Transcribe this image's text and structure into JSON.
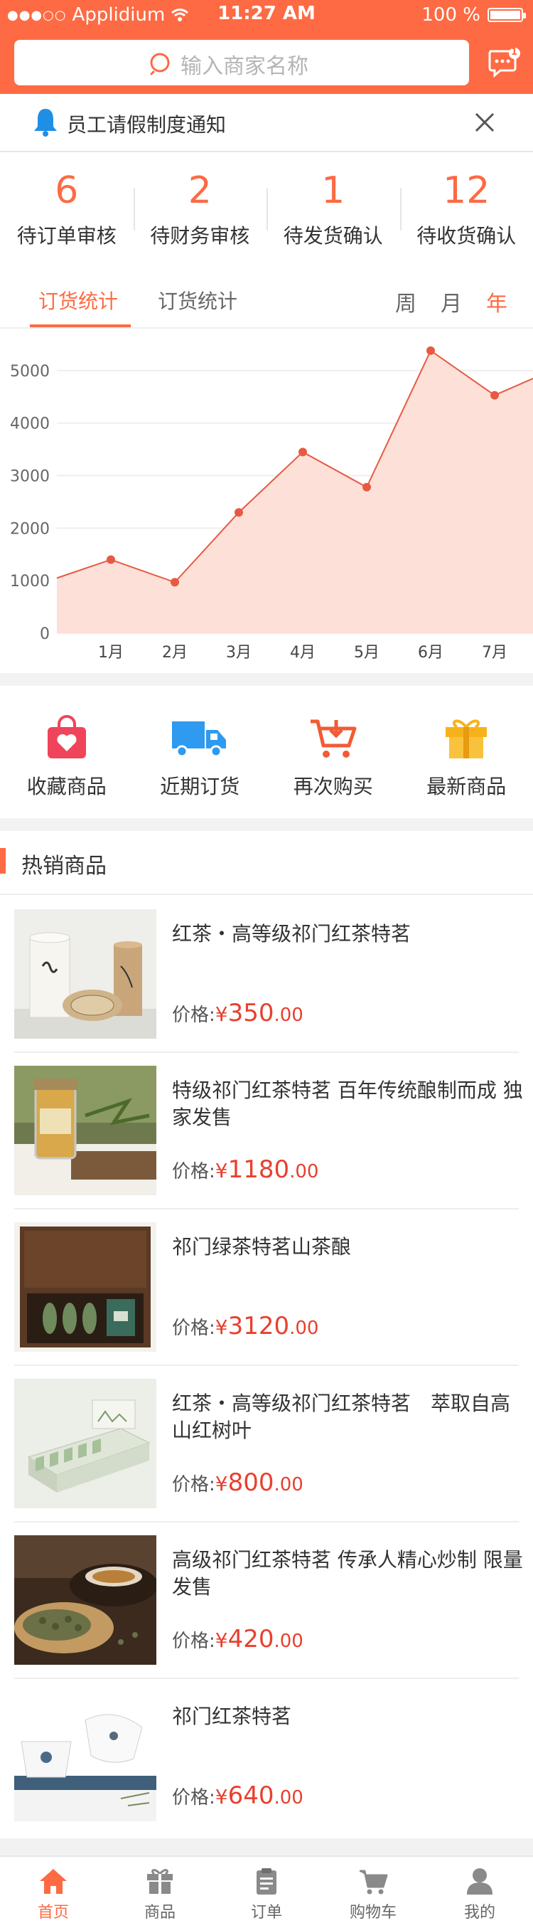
{
  "status_bar": {
    "carrier": "Applidium",
    "time": "11:27 AM",
    "battery": "100 %"
  },
  "search": {
    "placeholder": "输入商家名称"
  },
  "messages": {
    "badge": "1"
  },
  "notice": {
    "text": "员工请假制度通知"
  },
  "stats": [
    {
      "value": "6",
      "label": "待订单审核"
    },
    {
      "value": "2",
      "label": "待财务审核"
    },
    {
      "value": "1",
      "label": "待发货确认"
    },
    {
      "value": "12",
      "label": "待收货确认"
    }
  ],
  "tabs": [
    {
      "label": "订货统计",
      "active": true
    },
    {
      "label": "订货统计",
      "active": false
    }
  ],
  "periods": [
    {
      "label": "周",
      "active": false
    },
    {
      "label": "月",
      "active": false
    },
    {
      "label": "年",
      "active": true
    }
  ],
  "chart_data": {
    "type": "area",
    "categories": [
      "1月",
      "2月",
      "3月",
      "4月",
      "5月",
      "6月",
      "7月"
    ],
    "x_start_value": 1050,
    "x_end_value": 4850,
    "values": [
      1400,
      970,
      2300,
      3450,
      2780,
      5380,
      4530
    ],
    "yticks": [
      0,
      1000,
      2000,
      3000,
      4000,
      5000
    ],
    "ylim": [
      0,
      5500
    ],
    "grid": true,
    "colors": {
      "line": "#e65a43",
      "fill": "#fde0d8",
      "point": "#e65a43"
    }
  },
  "quick_actions": [
    {
      "label": "收藏商品",
      "icon": "favorite-bag-icon"
    },
    {
      "label": "近期订货",
      "icon": "delivery-truck-icon"
    },
    {
      "label": "再次购买",
      "icon": "shopping-cart-icon"
    },
    {
      "label": "最新商品",
      "icon": "gift-box-icon"
    }
  ],
  "hot_section": {
    "title": "热销商品"
  },
  "products": [
    {
      "name": "红茶・高等级祁门红茶特茗",
      "price_label": "价格:",
      "currency": "¥",
      "price_int": "350",
      "price_dec": ".00"
    },
    {
      "name": "特级祁门红茶特茗 百年传统酿制而成 独家发售",
      "price_label": "价格:",
      "currency": "¥",
      "price_int": "1180",
      "price_dec": ".00"
    },
    {
      "name": "祁门绿茶特茗山茶酿",
      "price_label": "价格:",
      "currency": "¥",
      "price_int": "3120",
      "price_dec": ".00"
    },
    {
      "name": "红茶・高等级祁门红茶特茗　萃取自高山红树叶",
      "price_label": "价格:",
      "currency": "¥",
      "price_int": "800",
      "price_dec": ".00"
    },
    {
      "name": "高级祁门红茶特茗 传承人精心炒制 限量发售",
      "price_label": "价格:",
      "currency": "¥",
      "price_int": "420",
      "price_dec": ".00"
    },
    {
      "name": "祁门红茶特茗",
      "price_label": "价格:",
      "currency": "¥",
      "price_int": "640",
      "price_dec": ".00"
    }
  ],
  "tabbar": [
    {
      "label": "首页",
      "icon": "home-icon",
      "active": true
    },
    {
      "label": "商品",
      "icon": "gift-icon",
      "active": false
    },
    {
      "label": "订单",
      "icon": "clipboard-icon",
      "active": false
    },
    {
      "label": "购物车",
      "icon": "cart-icon",
      "active": false
    },
    {
      "label": "我的",
      "icon": "user-icon",
      "active": false
    }
  ],
  "colors": {
    "accent": "#fe6a43",
    "price": "#e8402e"
  }
}
